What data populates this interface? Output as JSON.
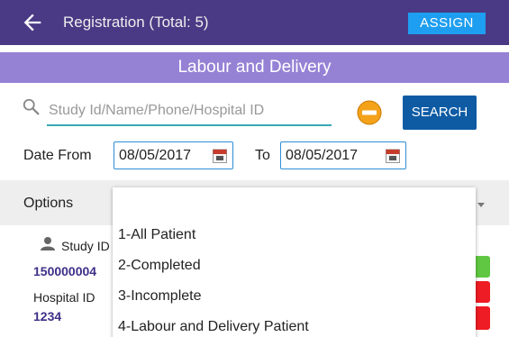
{
  "appbar": {
    "title": "Registration  (Total: 5)",
    "back_icon": "arrow-left-icon",
    "assign_label": "ASSIGN"
  },
  "section": {
    "title": "Labour and Delivery"
  },
  "search": {
    "placeholder": "Study Id/Name/Phone/Hospital ID",
    "value": "",
    "button_label": "SEARCH",
    "icon": "search-icon",
    "clear_icon": "minus-circle-icon"
  },
  "dates": {
    "from_label": "Date From",
    "from_value": "08/05/2017",
    "to_label": "To",
    "to_value": "08/05/2017",
    "calendar_icon": "calendar-icon"
  },
  "options": {
    "label": "Options",
    "items": [
      "1-All Patient",
      "2-Completed",
      "3-Incomplete",
      "4-Labour and Delivery Patient"
    ]
  },
  "patient": {
    "study_id_label": "Study ID",
    "study_id_value": "150000004",
    "hospital_id_label": "Hospital ID",
    "hospital_id_value": "1234",
    "person_icon": "person-icon"
  },
  "colors": {
    "appbar": "#4a3a85",
    "section": "#9582d5",
    "accent": "#1e9ef0",
    "search_button": "#0e5ba4",
    "status_green": "#5fc742",
    "status_red": "#ee1c24"
  }
}
